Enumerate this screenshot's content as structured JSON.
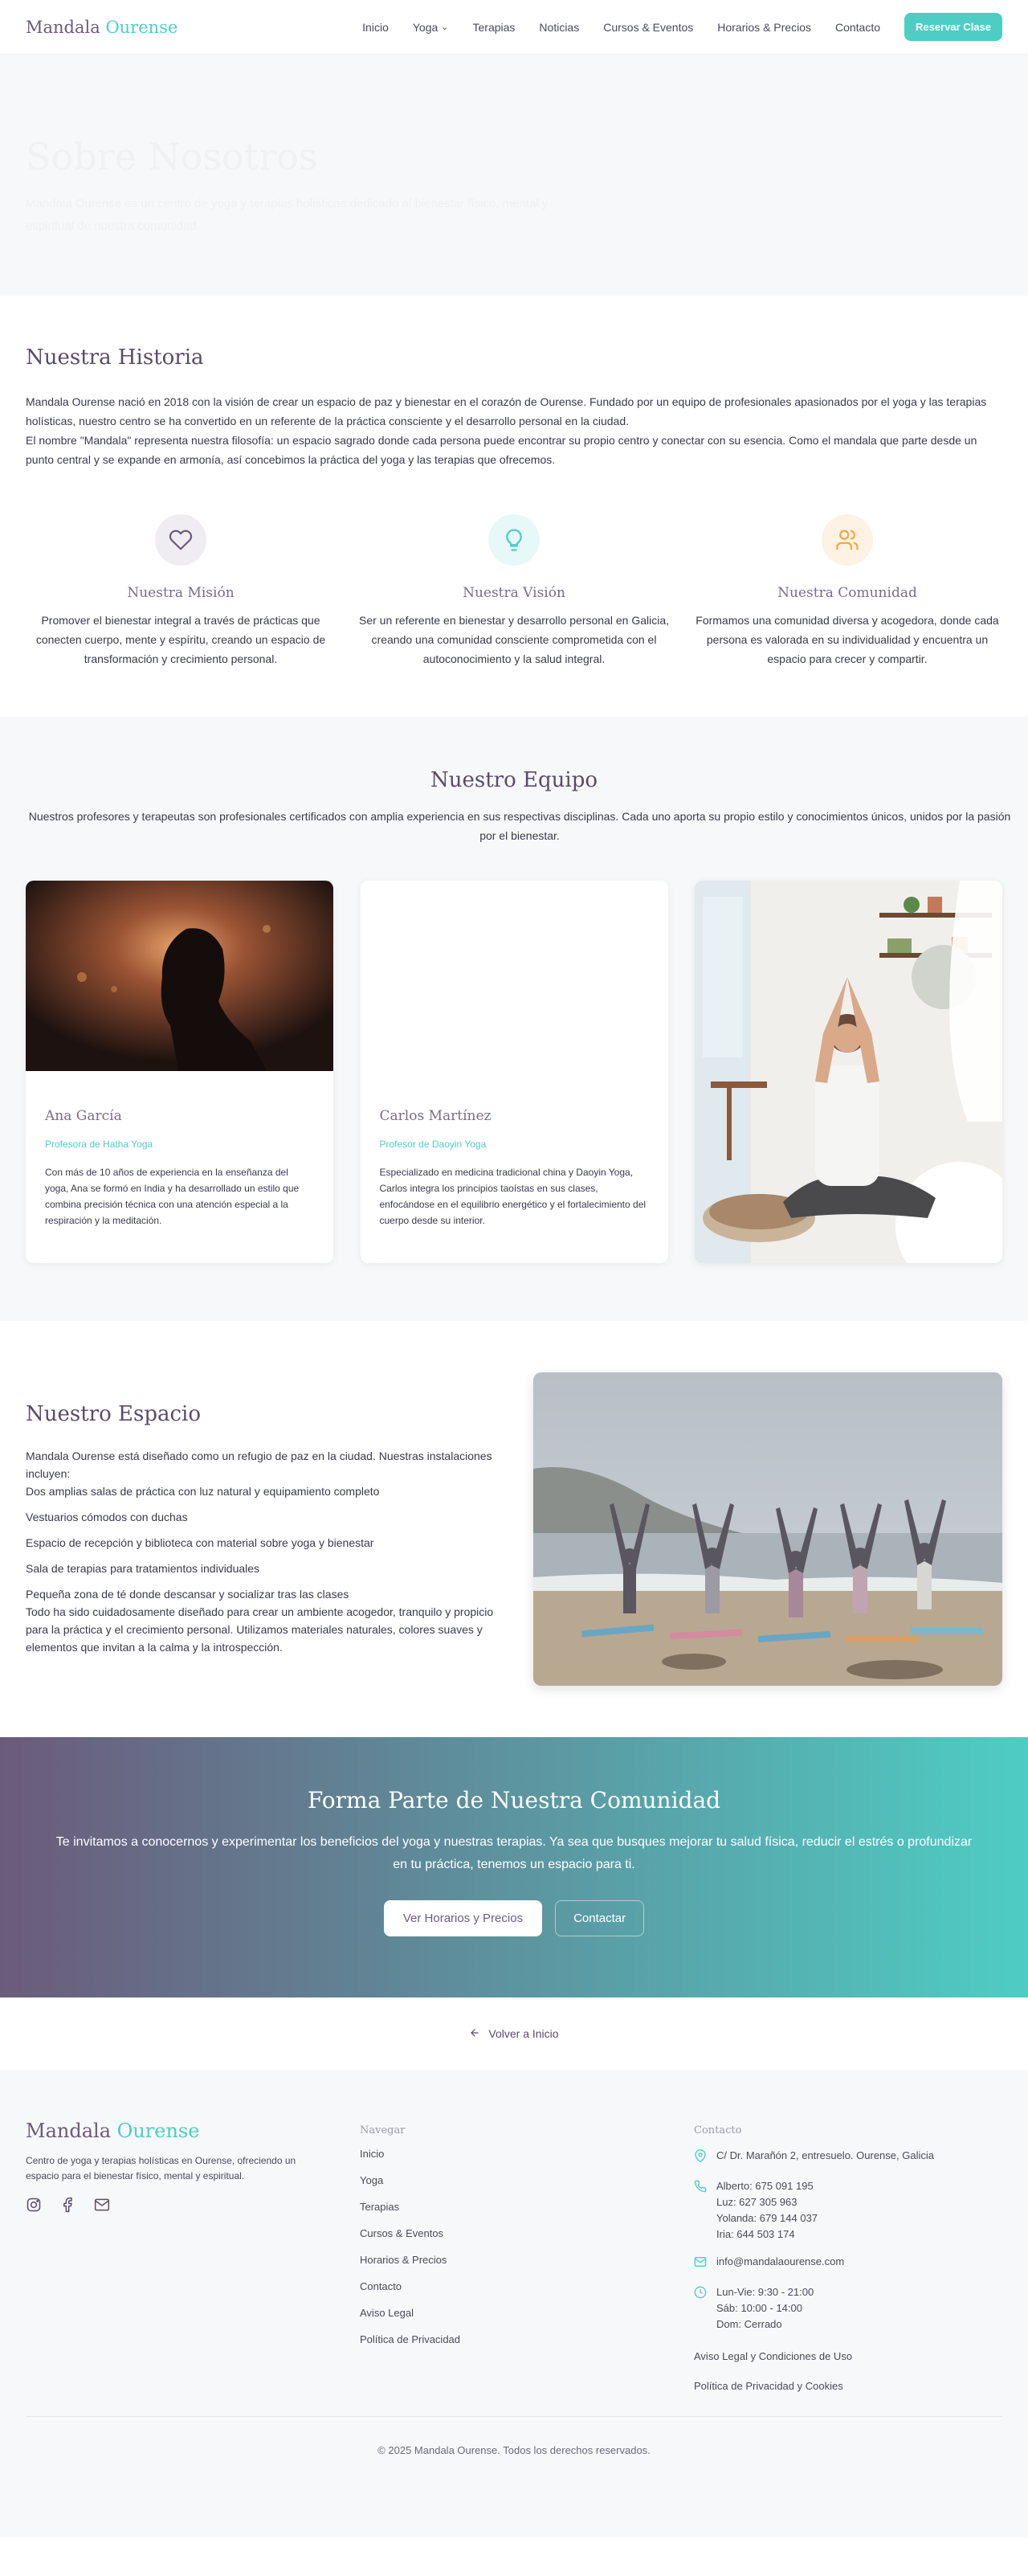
{
  "header": {
    "logo_main": "Mandala",
    "logo_accent": "Ourense",
    "nav": [
      "Inicio",
      "Yoga",
      "Terapias",
      "Noticias",
      "Cursos & Eventos",
      "Horarios & Precios",
      "Contacto"
    ],
    "cta": "Reservar Clase"
  },
  "hero": {
    "title": "Sobre Nosotros",
    "subtitle": "Mandala Ourense es un centro de yoga y terapias holísticas dedicado al bienestar físico, mental y espiritual de nuestra comunidad."
  },
  "historia": {
    "title": "Nuestra Historia",
    "p1": "Mandala Ourense nació en 2018 con la visión de crear un espacio de paz y bienestar en el corazón de Ourense. Fundado por un equipo de profesionales apasionados por el yoga y las terapias holísticas, nuestro centro se ha convertido en un referente de la práctica consciente y el desarrollo personal en la ciudad.",
    "p2": "El nombre \"Mandala\" representa nuestra filosofía: un espacio sagrado donde cada persona puede encontrar su propio centro y conectar con su esencia. Como el mandala que parte desde un punto central y se expande en armonía, así concebimos la práctica del yoga y las terapias que ofrecemos."
  },
  "values": [
    {
      "icon": "heart-icon",
      "color": "#6b5b7b",
      "bg": "#efedf2",
      "title": "Nuestra Misión",
      "text": "Promover el bienestar integral a través de prácticas que conecten cuerpo, mente y espíritu, creando un espacio de transformación y crecimiento personal."
    },
    {
      "icon": "lightbulb-icon",
      "color": "#4ecdc4",
      "bg": "#e6f8f7",
      "title": "Nuestra Visión",
      "text": "Ser un referente en bienestar y desarrollo personal en Galicia, creando una comunidad consciente comprometida con el autoconocimiento y la salud integral."
    },
    {
      "icon": "users-icon",
      "color": "#f5a742",
      "bg": "#fdf2e3",
      "title": "Nuestra Comunidad",
      "text": "Formamos una comunidad diversa y acogedora, donde cada persona es valorada en su individualidad y encuentra un espacio para crecer y compartir."
    }
  ],
  "equipo": {
    "title": "Nuestro Equipo",
    "lead": "Nuestros profesores y terapeutas son profesionales certificados con amplia experiencia en sus respectivas disciplinas. Cada uno aporta su propio estilo y conocimientos únicos, unidos por la pasión por el bienestar.",
    "members": [
      {
        "name": "Ana García",
        "role": "Profesora de Hatha Yoga",
        "bio": "Con más de 10 años de experiencia en la enseñanza del yoga, Ana se formó en India y ha desarrollado un estilo que combina precisión técnica con una atención especial a la respiración y la meditación."
      },
      {
        "name": "Carlos Martínez",
        "role": "Profesor de Daoyin Yoga",
        "bio": "Especializado en medicina tradicional china y Daoyin Yoga, Carlos integra los principios taoístas en sus clases, enfocándose en el equilibrio energético y el fortalecimiento del cuerpo desde su interior."
      }
    ]
  },
  "espacio": {
    "title": "Nuestro Espacio",
    "intro": "Mandala Ourense está diseñado como un refugio de paz en la ciudad. Nuestras instalaciones incluyen:",
    "items": [
      "Dos amplias salas de práctica con luz natural y equipamiento completo",
      "Vestuarios cómodos con duchas",
      "Espacio de recepción y biblioteca con material sobre yoga y bienestar",
      "Sala de terapias para tratamientos individuales",
      "Pequeña zona de té donde descansar y socializar tras las clases"
    ],
    "outro": "Todo ha sido cuidadosamente diseñado para crear un ambiente acogedor, tranquilo y propicio para la práctica y el crecimiento personal. Utilizamos materiales naturales, colores suaves y elementos que invitan a la calma y la introspección."
  },
  "cta": {
    "title": "Forma Parte de Nuestra Comunidad",
    "text": "Te invitamos a conocernos y experimentar los beneficios del yoga y nuestras terapias. Ya sea que busques mejorar tu salud física, reducir el estrés o profundizar en tu práctica, tenemos un espacio para ti.",
    "primary": "Ver Horarios y Precios",
    "secondary": "Contactar"
  },
  "back": "Volver a Inicio",
  "footer": {
    "logo_main": "Mandala",
    "logo_accent": "Ourense",
    "description": "Centro de yoga y terapias holísticas en Ourense, ofreciendo un espacio para el bienestar físico, mental y espiritual.",
    "nav_title": "Navegar",
    "nav": [
      "Inicio",
      "Yoga",
      "Terapias",
      "Cursos & Eventos",
      "Horarios & Precios",
      "Contacto",
      "Aviso Legal",
      "Política de Privacidad"
    ],
    "contact_title": "Contacto",
    "address": "C/ Dr. Marañón 2, entresuelo. Ourense, Galicia",
    "phones": [
      "Alberto: 675 091 195",
      "Luz: 627 305 963",
      "Yolanda: 679 144 037",
      "Iria: 644 503 174"
    ],
    "email": "info@mandalaourense.com",
    "hours": [
      "Lun-Vie: 9:30 - 21:00",
      "Sáb: 10:00 - 14:00",
      "Dom: Cerrado"
    ],
    "legal1": "Aviso Legal y Condiciones de Uso",
    "legal2": "Política de Privacidad y Cookies",
    "copyright": "© 2025 Mandala Ourense. Todos los derechos reservados."
  }
}
